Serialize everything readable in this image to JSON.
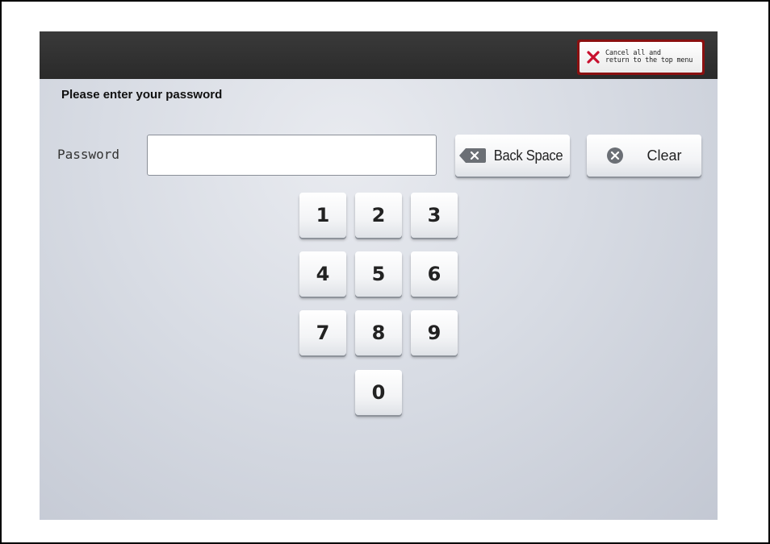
{
  "header": {
    "cancel_label": "Cancel all and\nreturn to the top menu"
  },
  "title": "Please enter your password",
  "password": {
    "label": "Password",
    "value": "",
    "placeholder": ""
  },
  "actions": {
    "backspace_label": "Back Space",
    "clear_label": "Clear"
  },
  "keypad": {
    "k1": "1",
    "k2": "2",
    "k3": "3",
    "k4": "4",
    "k5": "5",
    "k6": "6",
    "k7": "7",
    "k8": "8",
    "k9": "9",
    "k0": "0"
  },
  "colors": {
    "topbar": "#2f2f2f",
    "cancel_border": "#8a1010",
    "cancel_icon": "#c8102e",
    "background": "#d8dce4",
    "icon_gray": "#6b6f75"
  },
  "icons": {
    "cancel": "close-x-icon",
    "backspace": "backspace-icon",
    "clear": "clear-circle-x-icon"
  }
}
